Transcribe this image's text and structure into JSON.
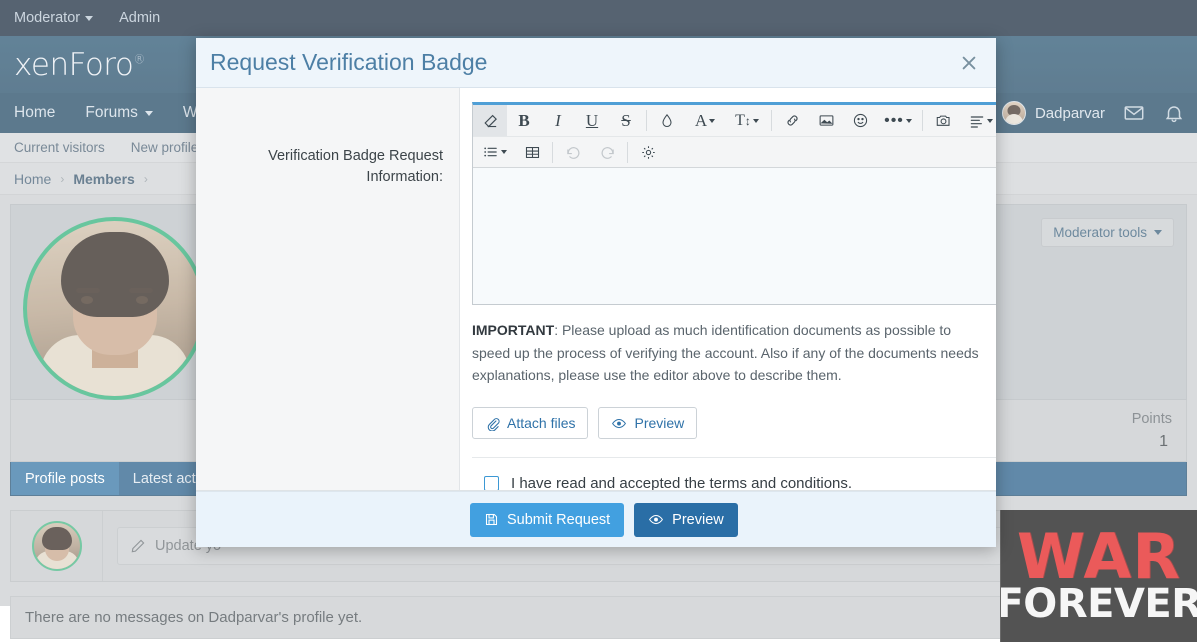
{
  "staffbar": {
    "items": [
      {
        "label": "Moderator",
        "has_caret": true
      },
      {
        "label": "Admin",
        "has_caret": false
      }
    ]
  },
  "header": {
    "logo_text": "xenForo",
    "logo_mark": "®"
  },
  "nav": {
    "items": [
      {
        "label": "Home",
        "has_caret": false
      },
      {
        "label": "Forums",
        "has_caret": true
      },
      {
        "label": "Wh",
        "has_caret": false
      }
    ],
    "user": {
      "name": "Dadparvar",
      "avatar": "user-avatar",
      "inbox_icon": "envelope-icon",
      "alerts_icon": "bell-icon"
    }
  },
  "subnav": {
    "items": [
      {
        "label": "Current visitors"
      },
      {
        "label": "New profile pos"
      }
    ]
  },
  "breadcrumb": {
    "items": [
      {
        "label": "Home",
        "strong": false
      },
      {
        "label": "Members",
        "strong": true
      }
    ],
    "separator": "›"
  },
  "profile": {
    "moderator_tools_label": "Moderator tools",
    "points_label": "Points",
    "points_value": "1",
    "tabs": [
      {
        "label": "Profile posts",
        "active": true
      },
      {
        "label": "Latest activi",
        "active": false
      }
    ],
    "status_placeholder": "Update yo",
    "empty_message": "There are no messages on Dadparvar's profile yet."
  },
  "banner": {
    "line1": "WAR",
    "line2": "FOREVER",
    "color_red": "#e21313",
    "color_white": "#f2f2f2",
    "background": "#0a0a0a"
  },
  "modal": {
    "title": "Request Verification Badge",
    "close_icon": "close-icon",
    "field_label": "Verification Badge Request Information:",
    "editor": {
      "value": "",
      "toolbar_row1": [
        {
          "name": "remove-format-icon",
          "glyph": "eraser",
          "active": true,
          "caret": false
        },
        {
          "name": "bold-icon",
          "glyph": "B",
          "active": false,
          "caret": false
        },
        {
          "name": "italic-icon",
          "glyph": "I",
          "active": false,
          "caret": false
        },
        {
          "name": "underline-icon",
          "glyph": "U",
          "active": false,
          "caret": false
        },
        {
          "name": "strikethrough-icon",
          "glyph": "S",
          "active": false,
          "caret": false
        },
        {
          "name": "separator",
          "glyph": "sep",
          "active": false,
          "caret": false
        },
        {
          "name": "text-color-icon",
          "glyph": "drop",
          "active": false,
          "caret": false
        },
        {
          "name": "font-family-icon",
          "glyph": "A",
          "active": false,
          "caret": true
        },
        {
          "name": "font-size-icon",
          "glyph": "Tt",
          "active": false,
          "caret": true
        },
        {
          "name": "separator",
          "glyph": "sep",
          "active": false,
          "caret": false
        },
        {
          "name": "link-icon",
          "glyph": "link",
          "active": false,
          "caret": false
        },
        {
          "name": "image-icon",
          "glyph": "image",
          "active": false,
          "caret": false
        },
        {
          "name": "smilie-icon",
          "glyph": "smiley",
          "active": false,
          "caret": false
        },
        {
          "name": "more-options-icon",
          "glyph": "ellipsis",
          "active": false,
          "caret": true
        },
        {
          "name": "separator",
          "glyph": "sep",
          "active": false,
          "caret": false
        },
        {
          "name": "media-icon",
          "glyph": "camera",
          "active": false,
          "caret": false
        },
        {
          "name": "align-icon",
          "glyph": "align",
          "active": false,
          "caret": true
        }
      ],
      "toolbar_row2": [
        {
          "name": "list-icon",
          "glyph": "list",
          "active": false,
          "caret": true,
          "disabled": false
        },
        {
          "name": "table-icon",
          "glyph": "table",
          "active": false,
          "caret": false,
          "disabled": false
        },
        {
          "name": "separator",
          "glyph": "sep",
          "active": false,
          "caret": false,
          "disabled": false
        },
        {
          "name": "undo-icon",
          "glyph": "undo",
          "active": false,
          "caret": false,
          "disabled": true
        },
        {
          "name": "redo-icon",
          "glyph": "redo",
          "active": false,
          "caret": false,
          "disabled": true
        },
        {
          "name": "separator",
          "glyph": "sep",
          "active": false,
          "caret": false,
          "disabled": false
        },
        {
          "name": "settings-icon",
          "glyph": "gear",
          "active": false,
          "caret": false,
          "disabled": false
        }
      ]
    },
    "note": {
      "strong": "IMPORTANT",
      "rest": ": Please upload as much identification documents as possible to speed up the process of verifying the account. Also if any of the documents needs explanations, please use the editor above to describe them."
    },
    "attach_label": "Attach files",
    "preview_label": "Preview",
    "terms": {
      "label": "I have read and accepted the terms and conditions.",
      "checked": false
    },
    "footer": {
      "submit_label": "Submit Request",
      "preview_label": "Preview",
      "submit_color": "#42a0e0",
      "preview_color": "#2a6ea6"
    }
  }
}
